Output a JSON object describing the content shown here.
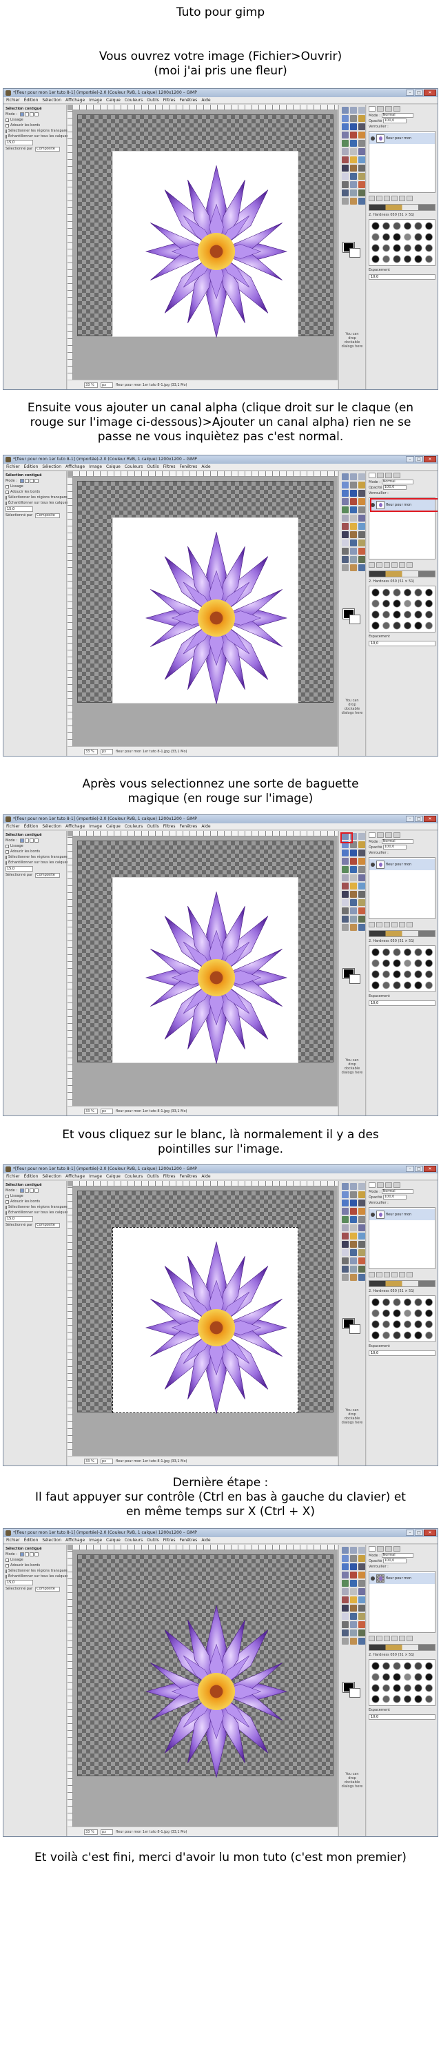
{
  "captions": {
    "title": "Tuto pour gimp",
    "step1": "Vous ouvrez votre image (Fichier>Ouvrir)\n(moi j'ai pris une fleur)",
    "step2": "Ensuite vous ajouter un canal alpha (clique droit sur le claque (en\nrouge sur l'image ci-dessous)>Ajouter un canal alpha) rien ne se\npasse ne vous inquiètez pas c'est normal.",
    "step3": "Après vous selectionnez une sorte de baguette\nmagique (en rouge sur l'image)",
    "step4": "Et vous cliquez sur le blanc, là normalement il y a des\npointilles sur l'image.",
    "step5": "Dernière étape :\nIl faut appuyer sur contrôle (Ctrl en bas à gauche du clavier) et\nen même temps sur X (Ctrl + X)",
    "end": "Et voilà c'est fini, merci d'avoir lu mon tuto (c'est mon premier)"
  },
  "gimp": {
    "window_title": "*[fleur pour mon 1er tuto 8-1] (importée)-2.0 (Couleur RVB, 1 calque) 1200x1200 – GIMP",
    "window_buttons": [
      "–",
      "□",
      "✕"
    ],
    "menus": [
      "Fichier",
      "Édition",
      "Sélection",
      "Affichage",
      "Image",
      "Calque",
      "Couleurs",
      "Outils",
      "Filtres",
      "Fenêtres",
      "Aide"
    ],
    "tool_options": {
      "title": "Sélection contiguë",
      "mode_label": "Mode :",
      "antialias": "Lissage",
      "feather": "Adoucir les bords",
      "transparent": "Sélectionner les régions transparentes",
      "sample_merged": "Échantillonner sur tous les calques",
      "threshold_value": "15,0",
      "select_by_label": "Sélectionné par",
      "select_by_value": "Composite"
    },
    "status": {
      "zoom": "33 %",
      "unit": "px",
      "text": "fleur pour mon 1er tuto 8-1.jpg (33,1 Mo)"
    },
    "toolbox": {
      "drop_text": "You can drop dockable dialogs here"
    },
    "layers": {
      "mode_label": "Mode :",
      "mode_value": "Normal",
      "opacity_label": "Opacité",
      "opacity_value": "100,0",
      "lock_label": "Verrouiller :",
      "layer_name": "fleur pour mon"
    },
    "brushes": {
      "filter_label": "2. Hardness 050 (51 × 51)",
      "spacing_label": "Espacement",
      "spacing_value": "10,0"
    }
  }
}
